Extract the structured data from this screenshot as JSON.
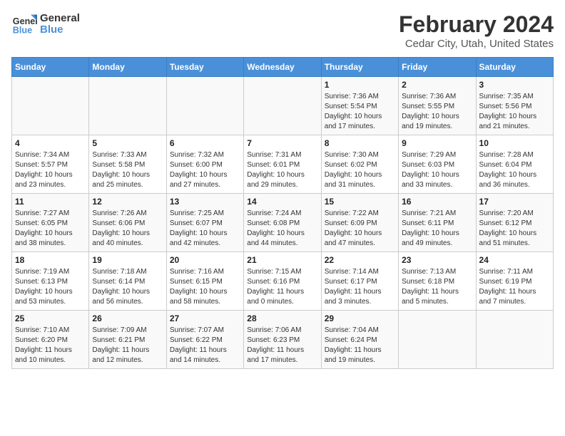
{
  "header": {
    "logo_line1": "General",
    "logo_line2": "Blue",
    "main_title": "February 2024",
    "subtitle": "Cedar City, Utah, United States"
  },
  "weekdays": [
    "Sunday",
    "Monday",
    "Tuesday",
    "Wednesday",
    "Thursday",
    "Friday",
    "Saturday"
  ],
  "weeks": [
    [
      {
        "day": "",
        "info": ""
      },
      {
        "day": "",
        "info": ""
      },
      {
        "day": "",
        "info": ""
      },
      {
        "day": "",
        "info": ""
      },
      {
        "day": "1",
        "info": "Sunrise: 7:36 AM\nSunset: 5:54 PM\nDaylight: 10 hours\nand 17 minutes."
      },
      {
        "day": "2",
        "info": "Sunrise: 7:36 AM\nSunset: 5:55 PM\nDaylight: 10 hours\nand 19 minutes."
      },
      {
        "day": "3",
        "info": "Sunrise: 7:35 AM\nSunset: 5:56 PM\nDaylight: 10 hours\nand 21 minutes."
      }
    ],
    [
      {
        "day": "4",
        "info": "Sunrise: 7:34 AM\nSunset: 5:57 PM\nDaylight: 10 hours\nand 23 minutes."
      },
      {
        "day": "5",
        "info": "Sunrise: 7:33 AM\nSunset: 5:58 PM\nDaylight: 10 hours\nand 25 minutes."
      },
      {
        "day": "6",
        "info": "Sunrise: 7:32 AM\nSunset: 6:00 PM\nDaylight: 10 hours\nand 27 minutes."
      },
      {
        "day": "7",
        "info": "Sunrise: 7:31 AM\nSunset: 6:01 PM\nDaylight: 10 hours\nand 29 minutes."
      },
      {
        "day": "8",
        "info": "Sunrise: 7:30 AM\nSunset: 6:02 PM\nDaylight: 10 hours\nand 31 minutes."
      },
      {
        "day": "9",
        "info": "Sunrise: 7:29 AM\nSunset: 6:03 PM\nDaylight: 10 hours\nand 33 minutes."
      },
      {
        "day": "10",
        "info": "Sunrise: 7:28 AM\nSunset: 6:04 PM\nDaylight: 10 hours\nand 36 minutes."
      }
    ],
    [
      {
        "day": "11",
        "info": "Sunrise: 7:27 AM\nSunset: 6:05 PM\nDaylight: 10 hours\nand 38 minutes."
      },
      {
        "day": "12",
        "info": "Sunrise: 7:26 AM\nSunset: 6:06 PM\nDaylight: 10 hours\nand 40 minutes."
      },
      {
        "day": "13",
        "info": "Sunrise: 7:25 AM\nSunset: 6:07 PM\nDaylight: 10 hours\nand 42 minutes."
      },
      {
        "day": "14",
        "info": "Sunrise: 7:24 AM\nSunset: 6:08 PM\nDaylight: 10 hours\nand 44 minutes."
      },
      {
        "day": "15",
        "info": "Sunrise: 7:22 AM\nSunset: 6:09 PM\nDaylight: 10 hours\nand 47 minutes."
      },
      {
        "day": "16",
        "info": "Sunrise: 7:21 AM\nSunset: 6:11 PM\nDaylight: 10 hours\nand 49 minutes."
      },
      {
        "day": "17",
        "info": "Sunrise: 7:20 AM\nSunset: 6:12 PM\nDaylight: 10 hours\nand 51 minutes."
      }
    ],
    [
      {
        "day": "18",
        "info": "Sunrise: 7:19 AM\nSunset: 6:13 PM\nDaylight: 10 hours\nand 53 minutes."
      },
      {
        "day": "19",
        "info": "Sunrise: 7:18 AM\nSunset: 6:14 PM\nDaylight: 10 hours\nand 56 minutes."
      },
      {
        "day": "20",
        "info": "Sunrise: 7:16 AM\nSunset: 6:15 PM\nDaylight: 10 hours\nand 58 minutes."
      },
      {
        "day": "21",
        "info": "Sunrise: 7:15 AM\nSunset: 6:16 PM\nDaylight: 11 hours\nand 0 minutes."
      },
      {
        "day": "22",
        "info": "Sunrise: 7:14 AM\nSunset: 6:17 PM\nDaylight: 11 hours\nand 3 minutes."
      },
      {
        "day": "23",
        "info": "Sunrise: 7:13 AM\nSunset: 6:18 PM\nDaylight: 11 hours\nand 5 minutes."
      },
      {
        "day": "24",
        "info": "Sunrise: 7:11 AM\nSunset: 6:19 PM\nDaylight: 11 hours\nand 7 minutes."
      }
    ],
    [
      {
        "day": "25",
        "info": "Sunrise: 7:10 AM\nSunset: 6:20 PM\nDaylight: 11 hours\nand 10 minutes."
      },
      {
        "day": "26",
        "info": "Sunrise: 7:09 AM\nSunset: 6:21 PM\nDaylight: 11 hours\nand 12 minutes."
      },
      {
        "day": "27",
        "info": "Sunrise: 7:07 AM\nSunset: 6:22 PM\nDaylight: 11 hours\nand 14 minutes."
      },
      {
        "day": "28",
        "info": "Sunrise: 7:06 AM\nSunset: 6:23 PM\nDaylight: 11 hours\nand 17 minutes."
      },
      {
        "day": "29",
        "info": "Sunrise: 7:04 AM\nSunset: 6:24 PM\nDaylight: 11 hours\nand 19 minutes."
      },
      {
        "day": "",
        "info": ""
      },
      {
        "day": "",
        "info": ""
      }
    ]
  ]
}
